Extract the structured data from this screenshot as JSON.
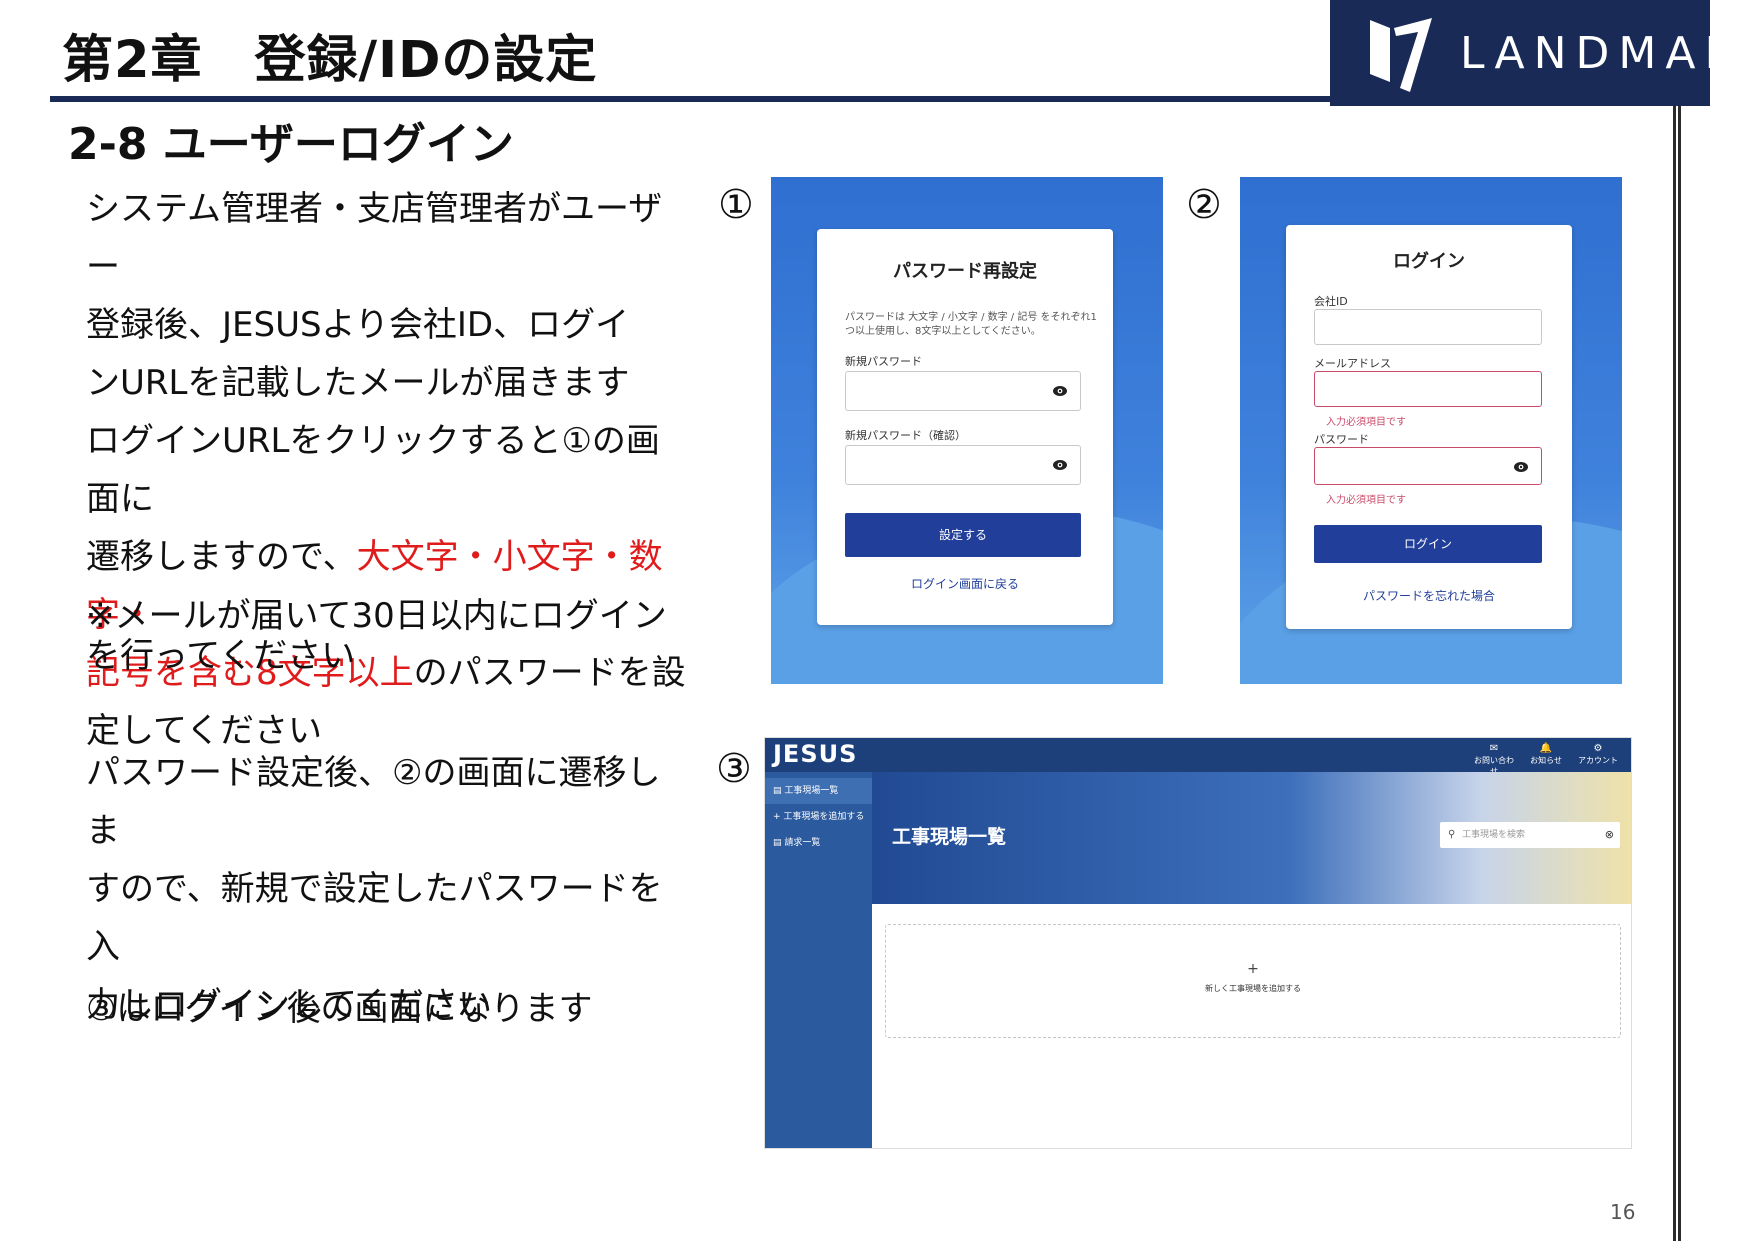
{
  "header": {
    "chapter_title": "第2章　登録/IDの設定",
    "logo_text": "LANDMARK",
    "section_title": "2-8  ユーザーログイン"
  },
  "body": {
    "para1_lines": [
      "システム管理者・支店管理者がユーザー",
      "登録後、JESUSより会社ID、ログイ",
      "ンURLを記載したメールが届きます",
      "ログインURLをクリックすると①の画面に",
      "遷移しますので、"
    ],
    "para1_red_a": "大文字・小文字・数字・",
    "para1_red_b": "記号を含む8文字以上",
    "para1_after": "のパスワードを設",
    "para1_last": "定してください",
    "note_line1": "※メールが届いて30日以内にログインを",
    "note_line2": "行ってください",
    "para2_lines": [
      "パスワード設定後、②の画面に遷移しま",
      "すので、新規で設定したパスワードを入",
      "力しログインしてください"
    ],
    "para3": "③はログイン後の画面になります"
  },
  "markers": {
    "one": "①",
    "two": "②",
    "three": "③"
  },
  "screen1": {
    "title": "パスワード再設定",
    "hint_line1": "パスワードは 大文字 / 小文字 / 数字 / 記号 をそれぞれ1",
    "hint_line2": "つ以上使用し、8文字以上としてください。",
    "new_password_label": "新規パスワード",
    "confirm_password_label": "新規パスワード（確認）",
    "submit_label": "設定する",
    "back_link": "ログイン画面に戻る"
  },
  "screen2": {
    "title": "ログイン",
    "company_id_label": "会社ID",
    "email_label": "メールアドレス",
    "email_error": "入力必須項目です",
    "password_label": "パスワード",
    "password_error": "入力必須項目です",
    "login_label": "ログイン",
    "forgot_link": "パスワードを忘れた場合"
  },
  "screen3": {
    "logo": "JESUS",
    "nav": [
      {
        "label": "お問い合わせ",
        "icon": "✉"
      },
      {
        "label": "お知らせ",
        "icon": "🔔"
      },
      {
        "label": "アカウント",
        "icon": "⚙"
      }
    ],
    "sidebar": [
      {
        "label": "工事現場一覧",
        "icon": "▤"
      },
      {
        "label": "工事現場を追加する",
        "icon": "+"
      },
      {
        "label": "請求一覧",
        "icon": "▤"
      }
    ],
    "page_title": "工事現場一覧",
    "search_placeholder": "工事現場を検索",
    "add_label": "新しく工事現場を追加する",
    "add_plus": "+"
  },
  "colors": {
    "brand_navy": "#1a2a57",
    "accent_red": "#e01b1b",
    "button_blue": "#213f9a",
    "panel_blue": "#3f82dc"
  },
  "footer": {
    "page_number": "16"
  }
}
